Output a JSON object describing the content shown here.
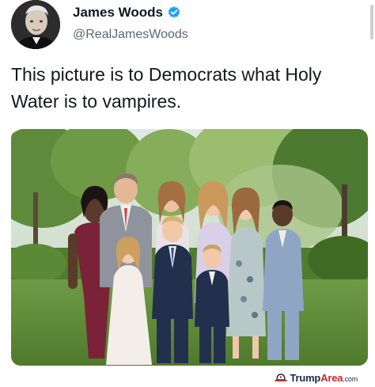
{
  "tweet": {
    "author": {
      "display_name": "James Woods",
      "handle": "@RealJamesWoods",
      "verified": true,
      "avatar_icon": "profile-photo-avatar"
    },
    "text": "This picture is to Democrats what Holy Water is to vampires.",
    "media": {
      "type": "photo",
      "icon": "family-group-photo"
    }
  },
  "watermark": {
    "icon": "hat-icon",
    "brand_primary": "Trump",
    "brand_accent": "Area",
    "tld": ".com"
  },
  "colors": {
    "text": "#14171a",
    "handle": "#5b6773",
    "verified": "#1da1f2",
    "watermark_accent": "#c62828",
    "watermark_primary": "#1a2a4a"
  }
}
